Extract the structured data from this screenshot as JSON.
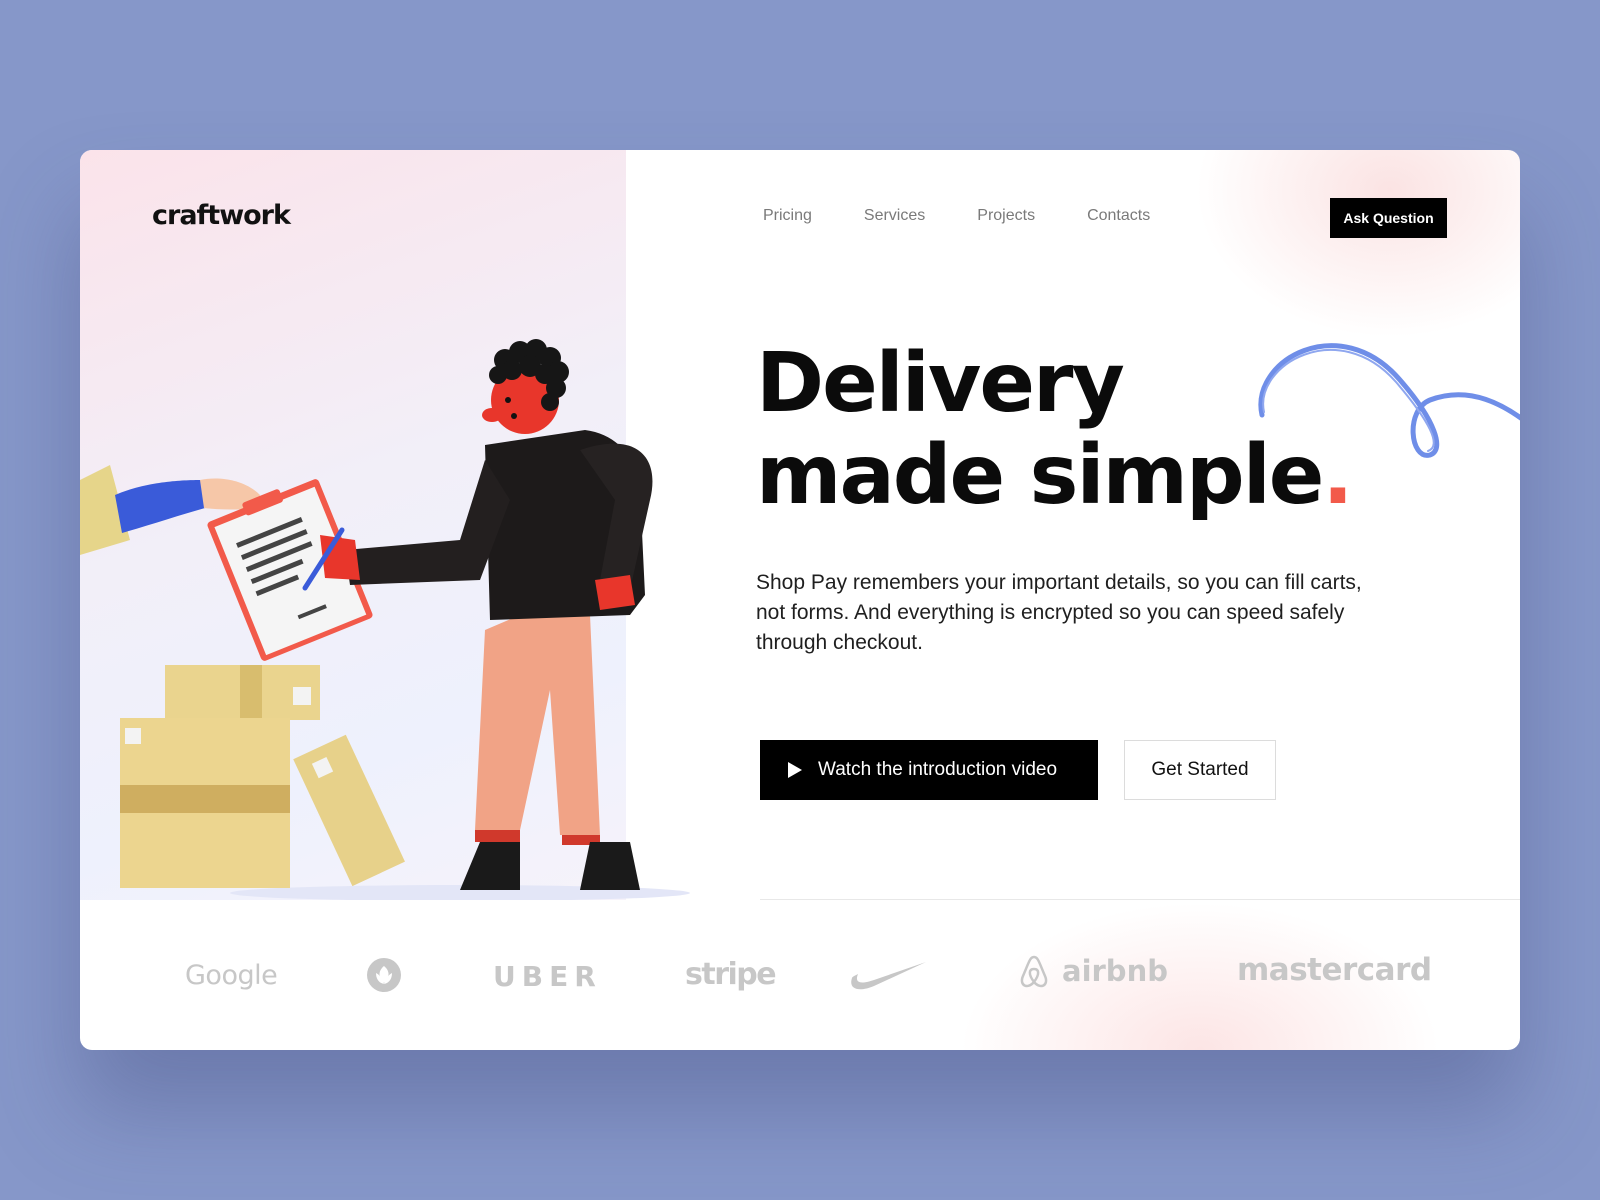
{
  "brand": {
    "logo": "craftwork"
  },
  "nav": {
    "items": [
      {
        "label": "Pricing"
      },
      {
        "label": "Services"
      },
      {
        "label": "Projects"
      },
      {
        "label": "Contacts"
      }
    ],
    "cta": "Ask Question"
  },
  "hero": {
    "title_line1": "Delivery",
    "title_line2": "made simple",
    "title_dot": ".",
    "description": "Shop Pay remembers your important details, so you can fill carts, not forms. And everything is encrypted so you can speed safely through checkout.",
    "primary_button": "Watch the introduction video",
    "secondary_button": "Get Started"
  },
  "partners": [
    {
      "name": "Google",
      "icon": "text"
    },
    {
      "name": "",
      "icon": "leaf-badge-icon"
    },
    {
      "name": "UBER",
      "icon": "text"
    },
    {
      "name": "stripe",
      "icon": "text"
    },
    {
      "name": "",
      "icon": "nike-swoosh-icon"
    },
    {
      "name": "airbnb",
      "icon": "airbnb-logo-icon"
    },
    {
      "name": "mastercard",
      "icon": "text"
    }
  ],
  "colors": {
    "background": "#8697c9",
    "accent_dot": "#f25a4a",
    "scribble": "#6f8ee8",
    "button_dark": "#000000",
    "logo_gray": "#c7c7c7"
  }
}
